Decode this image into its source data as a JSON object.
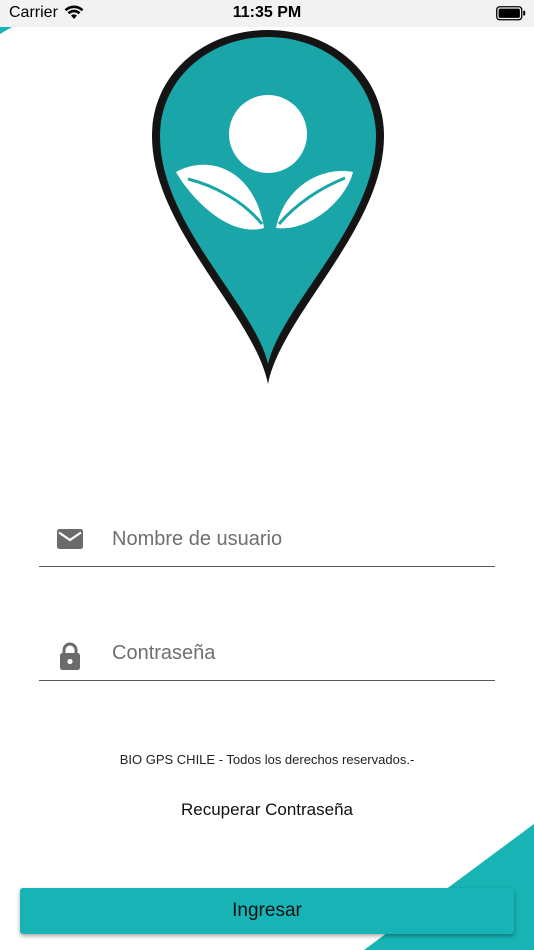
{
  "status_bar": {
    "carrier": "Carrier",
    "time": "11:35 PM",
    "wifi_icon": "wifi-icon",
    "battery_icon": "battery-full-icon"
  },
  "colors": {
    "accent": "#17b3b5",
    "logo_fill": "#1aa6a8",
    "text": "#222222"
  },
  "logo": {
    "icon": "map-pin-leaf-logo"
  },
  "login_form": {
    "username": {
      "icon": "mail-icon",
      "placeholder": "Nombre de usuario",
      "value": ""
    },
    "password": {
      "icon": "lock-icon",
      "placeholder": "Contraseña",
      "value": ""
    }
  },
  "footer": {
    "copyright": "BIO GPS CHILE - Todos los derechos reservados.-",
    "recover_password": "Recuperar Contraseña",
    "login_button": "Ingresar"
  }
}
